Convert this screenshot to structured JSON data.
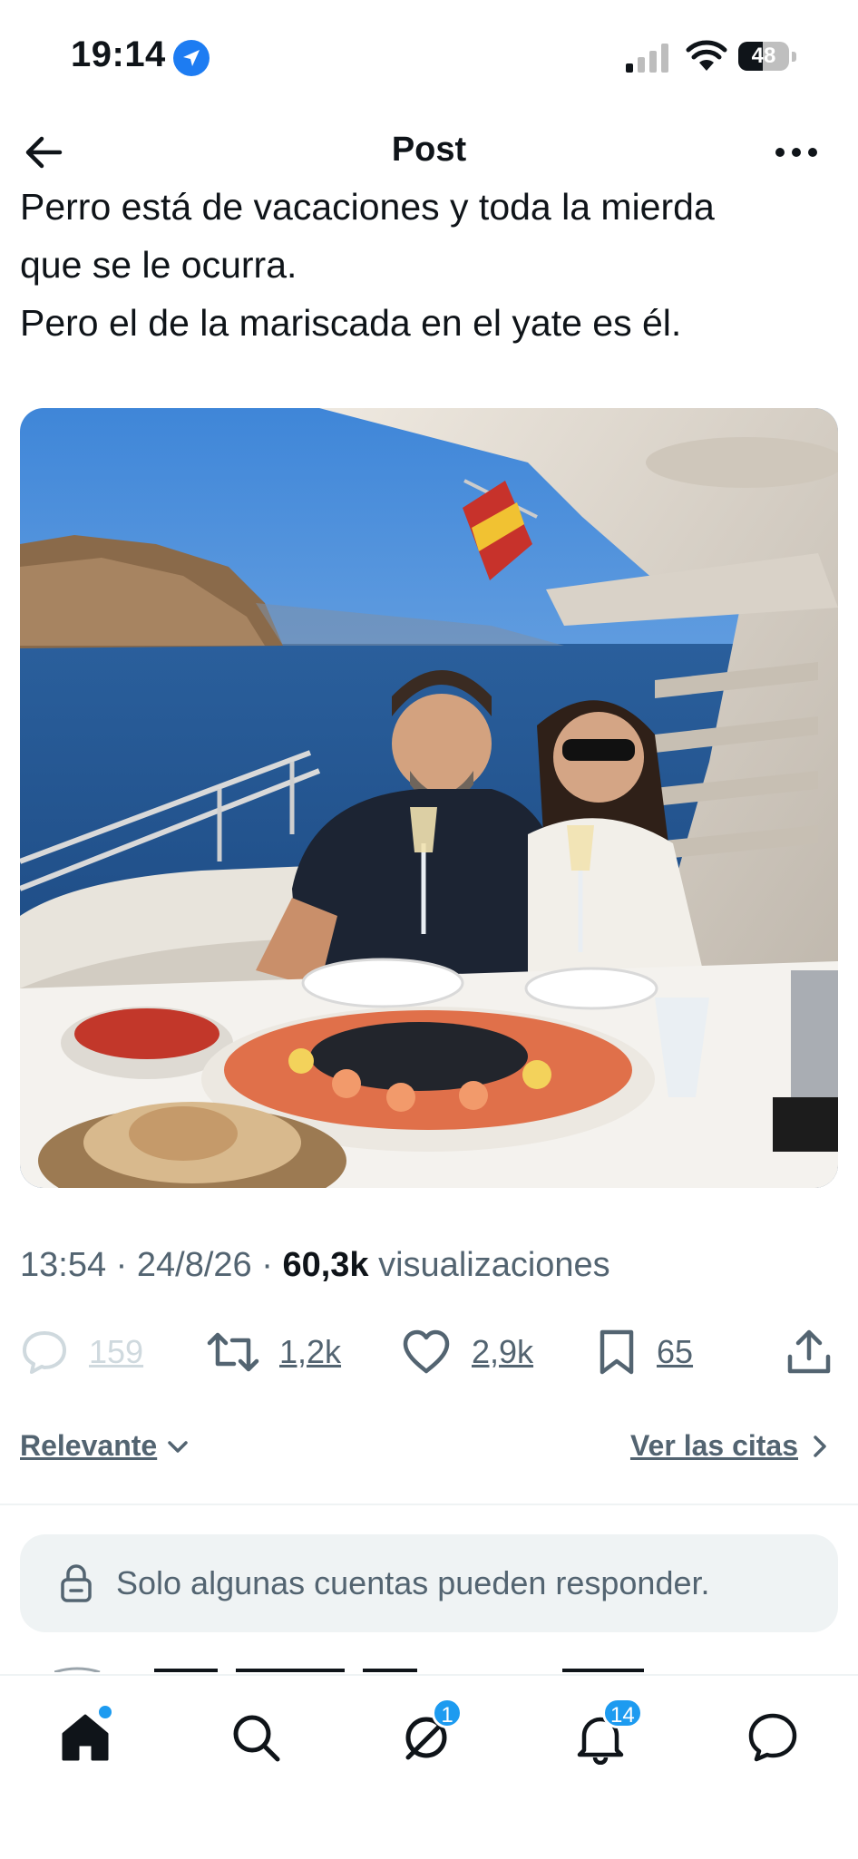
{
  "status_bar": {
    "time": "19:14",
    "battery_level": "48",
    "battery_fraction": 0.48
  },
  "header": {
    "title": "Post"
  },
  "post": {
    "text_lines": [
      "Perro está de vacaciones y toda la mierda",
      "que se le ocurra.",
      "Pero el de la mariscada en el yate es él."
    ],
    "meta": {
      "time": "13:54",
      "date": "24/8/26",
      "views_count": "60,3k",
      "views_label": "visualizaciones",
      "separator": " · "
    },
    "stats": {
      "replies": "159",
      "reposts": "1,2k",
      "likes": "2,9k",
      "bookmarks": "65"
    }
  },
  "sort": {
    "label": "Relevante",
    "quotes_link": "Ver las citas"
  },
  "reply_restriction": {
    "text": "Solo algunas cuentas pueden responder."
  },
  "tabbar": {
    "messages_badge": "1",
    "notifications_badge": "14"
  },
  "colors": {
    "accent": "#1d9bf0",
    "text": "#0f1419",
    "secondary": "#536471",
    "surface": "#eff3f4"
  }
}
